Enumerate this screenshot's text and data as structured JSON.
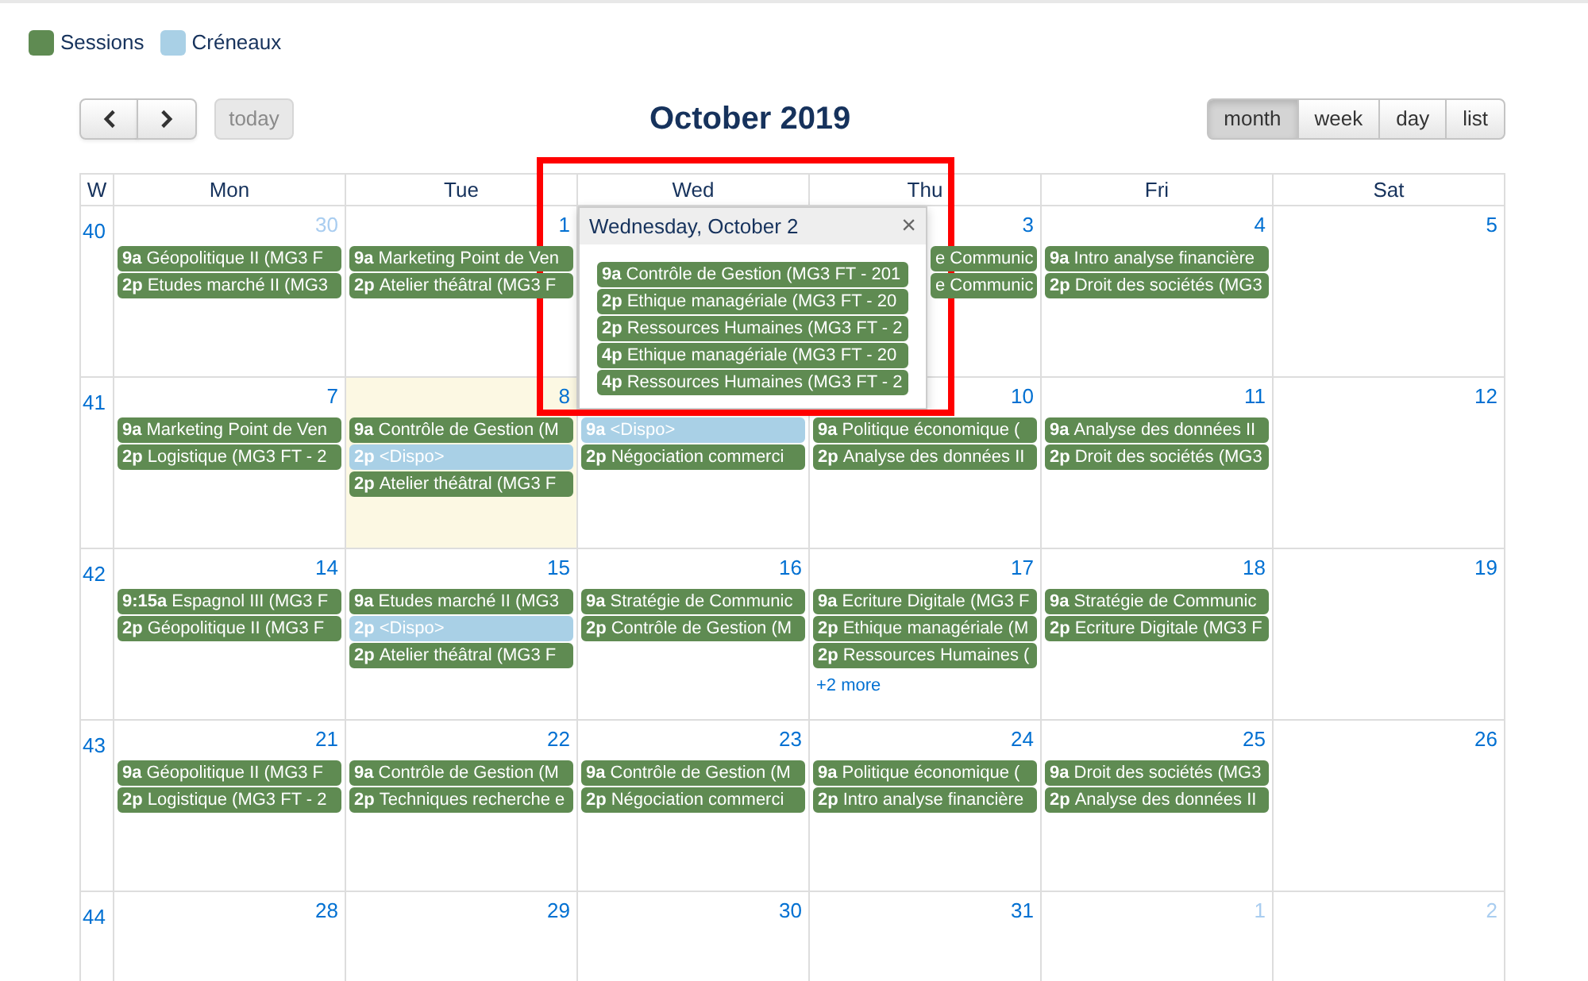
{
  "legend": [
    {
      "label": "Sessions",
      "color": "#5f8b52"
    },
    {
      "label": "Créneaux",
      "color": "#a9d0e6"
    }
  ],
  "toolbar": {
    "today": {
      "label": "today",
      "disabled": true
    },
    "title": "October 2019",
    "views": [
      {
        "label": "month",
        "selected": true
      },
      {
        "label": "week",
        "selected": false
      },
      {
        "label": "day",
        "selected": false
      },
      {
        "label": "list",
        "selected": false
      }
    ]
  },
  "calendar": {
    "columns": [
      "W",
      "Mon",
      "Tue",
      "Wed",
      "Thu",
      "Fri",
      "Sat"
    ],
    "weeks": [
      {
        "number": "40",
        "days": [
          {
            "date": "30",
            "other_month": true,
            "today": false,
            "events": [
              {
                "kind": "session",
                "time": "9a",
                "title": "Géopolitique II (MG3 F"
              },
              {
                "kind": "session",
                "time": "2p",
                "title": "Etudes marché II (MG3"
              }
            ]
          },
          {
            "date": "1",
            "other_month": false,
            "today": false,
            "events": [
              {
                "kind": "session",
                "time": "9a",
                "title": "Marketing Point de Ven"
              },
              {
                "kind": "session",
                "time": "2p",
                "title": "Atelier théâtral (MG3 F"
              }
            ]
          },
          {
            "popover": {
              "title": "Wednesday, October 2",
              "close": "×",
              "highlighted": true,
              "events": [
                {
                  "kind": "session",
                  "time": "9a",
                  "title": "Contrôle de Gestion (MG3 FT - 201"
                },
                {
                  "kind": "session",
                  "time": "2p",
                  "title": "Ethique managériale (MG3 FT - 20"
                },
                {
                  "kind": "session",
                  "time": "2p",
                  "title": "Ressources Humaines (MG3 FT - 2"
                },
                {
                  "kind": "session",
                  "time": "4p",
                  "title": "Ethique managériale (MG3 FT - 20"
                },
                {
                  "kind": "session",
                  "time": "4p",
                  "title": "Ressources Humaines (MG3 FT - 2"
                }
              ]
            }
          },
          {
            "date": "3",
            "other_month": false,
            "today": false,
            "events": [
              {
                "kind": "session",
                "title": "e Communic"
              },
              {
                "kind": "session",
                "title": "e Communic"
              }
            ]
          },
          {
            "date": "4",
            "other_month": false,
            "today": false,
            "events": [
              {
                "kind": "session",
                "time": "9a",
                "title": "Intro analyse financière"
              },
              {
                "kind": "session",
                "time": "2p",
                "title": "Droit des sociétés (MG3"
              }
            ]
          },
          {
            "date": "5",
            "other_month": false,
            "today": false
          }
        ]
      },
      {
        "number": "41",
        "days": [
          {
            "date": "7",
            "other_month": false,
            "today": false,
            "events": [
              {
                "kind": "session",
                "time": "9a",
                "title": "Marketing Point de Ven"
              },
              {
                "kind": "session",
                "time": "2p",
                "title": "Logistique (MG3 FT - 2"
              }
            ]
          },
          {
            "date": "8",
            "other_month": false,
            "today": true,
            "events": [
              {
                "kind": "session",
                "time": "9a",
                "title": "Contrôle de Gestion (M"
              },
              {
                "kind": "slot",
                "time": "2p",
                "title": "<Dispo>"
              },
              {
                "kind": "session",
                "time": "2p",
                "title": "Atelier théâtral (MG3 F"
              }
            ]
          },
          {
            "today": false,
            "events": [
              {
                "kind": "slot",
                "time": "9a",
                "title": "<Dispo>"
              },
              {
                "kind": "session",
                "time": "2p",
                "title": "Négociation commerci"
              }
            ]
          },
          {
            "date": "10",
            "other_month": false,
            "today": false,
            "events": [
              {
                "kind": "session",
                "time": "9a",
                "title": "Politique économique ("
              },
              {
                "kind": "session",
                "time": "2p",
                "title": "Analyse des données II"
              }
            ]
          },
          {
            "date": "11",
            "other_month": false,
            "today": false,
            "events": [
              {
                "kind": "session",
                "time": "9a",
                "title": "Analyse des données II"
              },
              {
                "kind": "session",
                "time": "2p",
                "title": "Droit des sociétés (MG3"
              }
            ]
          },
          {
            "date": "12",
            "other_month": false,
            "today": false
          }
        ]
      },
      {
        "number": "42",
        "days": [
          {
            "date": "14",
            "other_month": false,
            "today": false,
            "events": [
              {
                "kind": "session",
                "time": "9:15a",
                "title": "Espagnol III (MG3 F"
              },
              {
                "kind": "session",
                "time": "2p",
                "title": "Géopolitique II (MG3 F"
              }
            ]
          },
          {
            "date": "15",
            "other_month": false,
            "today": false,
            "events": [
              {
                "kind": "session",
                "time": "9a",
                "title": "Etudes marché II (MG3"
              },
              {
                "kind": "slot",
                "time": "2p",
                "title": "<Dispo>"
              },
              {
                "kind": "session",
                "time": "2p",
                "title": "Atelier théâtral (MG3 F"
              }
            ]
          },
          {
            "date": "16",
            "other_month": false,
            "today": false,
            "events": [
              {
                "kind": "session",
                "time": "9a",
                "title": "Stratégie de Communic"
              },
              {
                "kind": "session",
                "time": "2p",
                "title": "Contrôle de Gestion (M"
              }
            ]
          },
          {
            "date": "17",
            "other_month": false,
            "today": false,
            "events": [
              {
                "kind": "session",
                "time": "9a",
                "title": "Ecriture Digitale (MG3 F"
              },
              {
                "kind": "session",
                "time": "2p",
                "title": "Ethique managériale (M"
              },
              {
                "kind": "session",
                "time": "2p",
                "title": "Ressources Humaines ("
              }
            ],
            "more": "+2 more"
          },
          {
            "date": "18",
            "other_month": false,
            "today": false,
            "events": [
              {
                "kind": "session",
                "time": "9a",
                "title": "Stratégie de Communic"
              },
              {
                "kind": "session",
                "time": "2p",
                "title": "Ecriture Digitale (MG3 F"
              }
            ]
          },
          {
            "date": "19",
            "other_month": false,
            "today": false
          }
        ]
      },
      {
        "number": "43",
        "days": [
          {
            "date": "21",
            "other_month": false,
            "today": false,
            "events": [
              {
                "kind": "session",
                "time": "9a",
                "title": "Géopolitique II (MG3 F"
              },
              {
                "kind": "session",
                "time": "2p",
                "title": "Logistique (MG3 FT - 2"
              }
            ]
          },
          {
            "date": "22",
            "other_month": false,
            "today": false,
            "events": [
              {
                "kind": "session",
                "time": "9a",
                "title": "Contrôle de Gestion (M"
              },
              {
                "kind": "session",
                "time": "2p",
                "title": "Techniques recherche e"
              }
            ]
          },
          {
            "date": "23",
            "other_month": false,
            "today": false,
            "events": [
              {
                "kind": "session",
                "time": "9a",
                "title": "Contrôle de Gestion (M"
              },
              {
                "kind": "session",
                "time": "2p",
                "title": "Négociation commerci"
              }
            ]
          },
          {
            "date": "24",
            "other_month": false,
            "today": false,
            "events": [
              {
                "kind": "session",
                "time": "9a",
                "title": "Politique économique ("
              },
              {
                "kind": "session",
                "time": "2p",
                "title": "Intro analyse financière"
              }
            ]
          },
          {
            "date": "25",
            "other_month": false,
            "today": false,
            "events": [
              {
                "kind": "session",
                "time": "9a",
                "title": "Droit des sociétés (MG3"
              },
              {
                "kind": "session",
                "time": "2p",
                "title": "Analyse des données II"
              }
            ]
          },
          {
            "date": "26",
            "other_month": false,
            "today": false
          }
        ]
      },
      {
        "number": "44",
        "days": [
          {
            "date": "28",
            "other_month": false,
            "today": false
          },
          {
            "date": "29",
            "other_month": false,
            "today": false
          },
          {
            "date": "30",
            "other_month": false,
            "today": false
          },
          {
            "date": "31",
            "other_month": false,
            "today": false
          },
          {
            "date": "1",
            "other_month": true,
            "today": false
          },
          {
            "date": "2",
            "other_month": true,
            "today": false
          }
        ]
      }
    ]
  }
}
